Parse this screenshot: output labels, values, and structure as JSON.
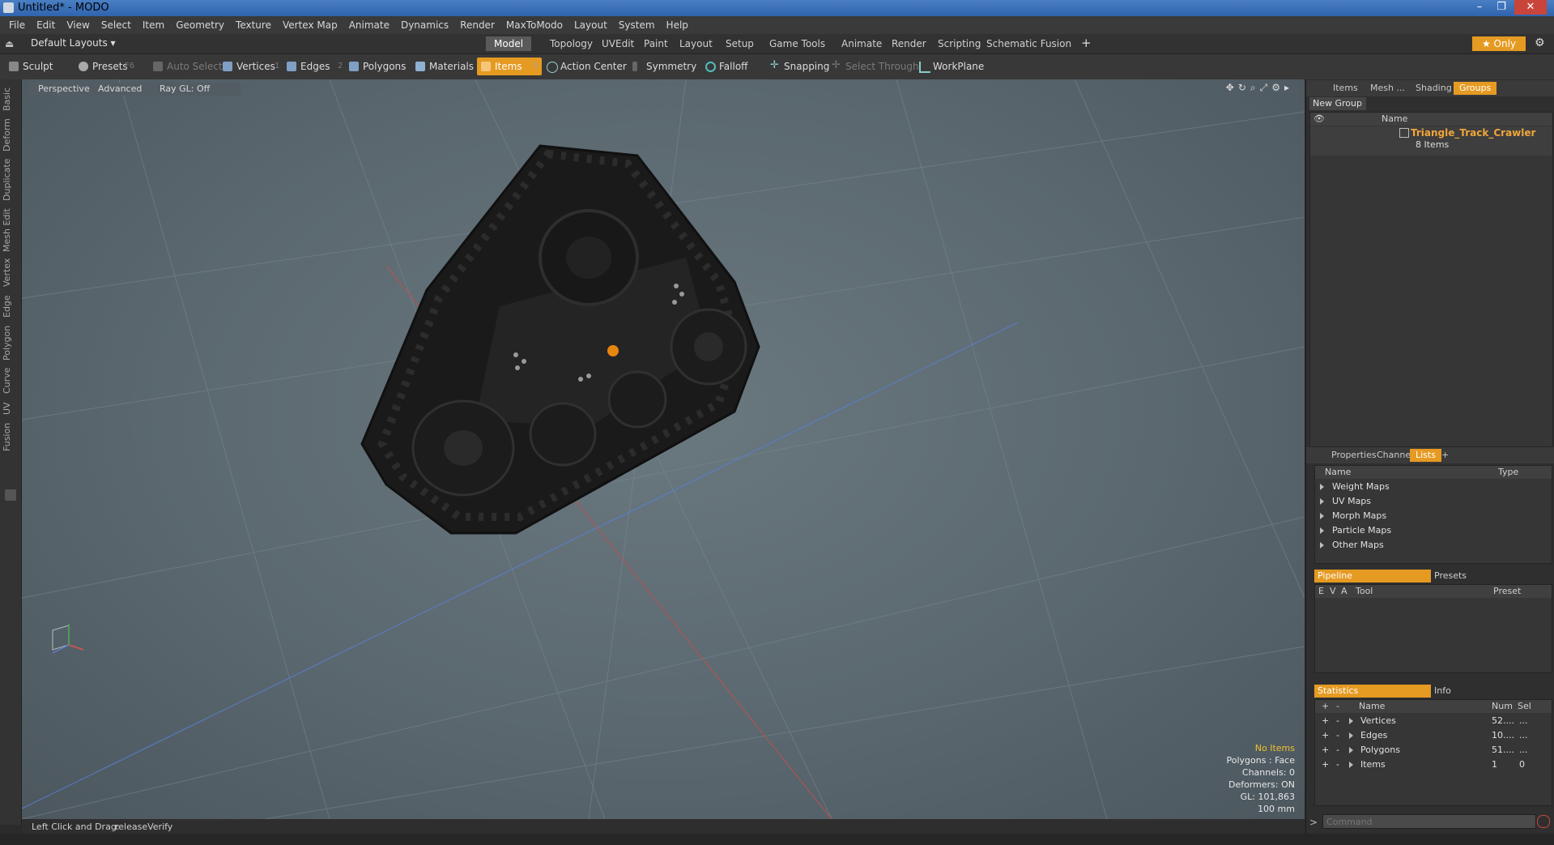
{
  "window": {
    "title": "Untitled* - MODO",
    "minimize": "–",
    "maximize": "❐",
    "close": "✕"
  },
  "menubar": [
    "File",
    "Edit",
    "View",
    "Select",
    "Item",
    "Geometry",
    "Texture",
    "Vertex Map",
    "Animate",
    "Dynamics",
    "Render",
    "MaxToModo",
    "Layout",
    "System",
    "Help"
  ],
  "layoutbar": {
    "layout_selector": "Default Layouts ▾",
    "tabs": [
      "Model",
      "Topology",
      "UVEdit",
      "Paint",
      "Layout",
      "Setup",
      "Game Tools",
      "Animate",
      "Render",
      "Scripting",
      "Schematic Fusion"
    ],
    "active_tab": "Model",
    "add": "+",
    "only": "★  Only"
  },
  "toolbar": {
    "sculpt": "Sculpt",
    "presets": "Presets",
    "presets_key": "F6",
    "auto_select": "Auto Select",
    "vertices": "Vertices",
    "vertices_key": "1",
    "edges": "Edges",
    "edges_key": "2",
    "polygons": "Polygons",
    "materials": "Materials",
    "items": "Items",
    "items_key": "5",
    "action_center": "Action Center",
    "symmetry": "Symmetry",
    "falloff": "Falloff",
    "snapping": "Snapping",
    "select_through": "Select Through",
    "workplane": "WorkPlane"
  },
  "left_tabs": [
    "Basic",
    "Deform",
    "Duplicate",
    "Mesh Edit",
    "Vertex",
    "Edge",
    "Polygon",
    "Curve",
    "UV",
    "Fusion"
  ],
  "viewport": {
    "view": "Perspective",
    "shading": "Advanced",
    "raygl": "Ray GL: Off",
    "info": {
      "no_items": "No Items",
      "polygons": "Polygons : Face",
      "channels": "Channels: 0",
      "deformers": "Deformers: ON",
      "gl": "GL: 101,863",
      "scale": "100 mm"
    }
  },
  "statusbar": {
    "hint_label": "Left Click and Drag:",
    "hint_value": "releaseVerify"
  },
  "groups_panel": {
    "tabs": [
      "Items",
      "Mesh ...",
      "Shading",
      "Groups"
    ],
    "active_tab": "Groups",
    "new_group": "New Group",
    "col_name": "Name",
    "group_name": "Triangle_Track_Crawler",
    "group_count": "8 Items"
  },
  "lists_panel": {
    "tabs": [
      "Properties",
      "Channels",
      "Lists"
    ],
    "active_tab": "Lists",
    "add": "+",
    "col_name": "Name",
    "col_type": "Type",
    "items": [
      "Weight Maps",
      "UV Maps",
      "Morph Maps",
      "Particle Maps",
      "Other Maps"
    ]
  },
  "pipeline_panel": {
    "tab_pipeline": "Pipeline",
    "tab_presets": "Presets",
    "cols": [
      "E",
      "V",
      "A",
      "Tool",
      "Preset"
    ]
  },
  "stats_panel": {
    "tab_statistics": "Statistics",
    "tab_info": "Info",
    "col_name": "Name",
    "col_num": "Num",
    "col_sel": "Sel",
    "rows": [
      {
        "name": "Vertices",
        "num": "52....",
        "sel": "..."
      },
      {
        "name": "Edges",
        "num": "10....",
        "sel": "..."
      },
      {
        "name": "Polygons",
        "num": "51....",
        "sel": "..."
      },
      {
        "name": "Items",
        "num": "1",
        "sel": "0"
      }
    ]
  },
  "command": {
    "prompt": ">",
    "placeholder": "Command"
  },
  "colors": {
    "accent": "#e59a22",
    "track": "#1a1a1a",
    "grid_red": "#c0504d",
    "grid_blue": "#5b7fd1"
  }
}
